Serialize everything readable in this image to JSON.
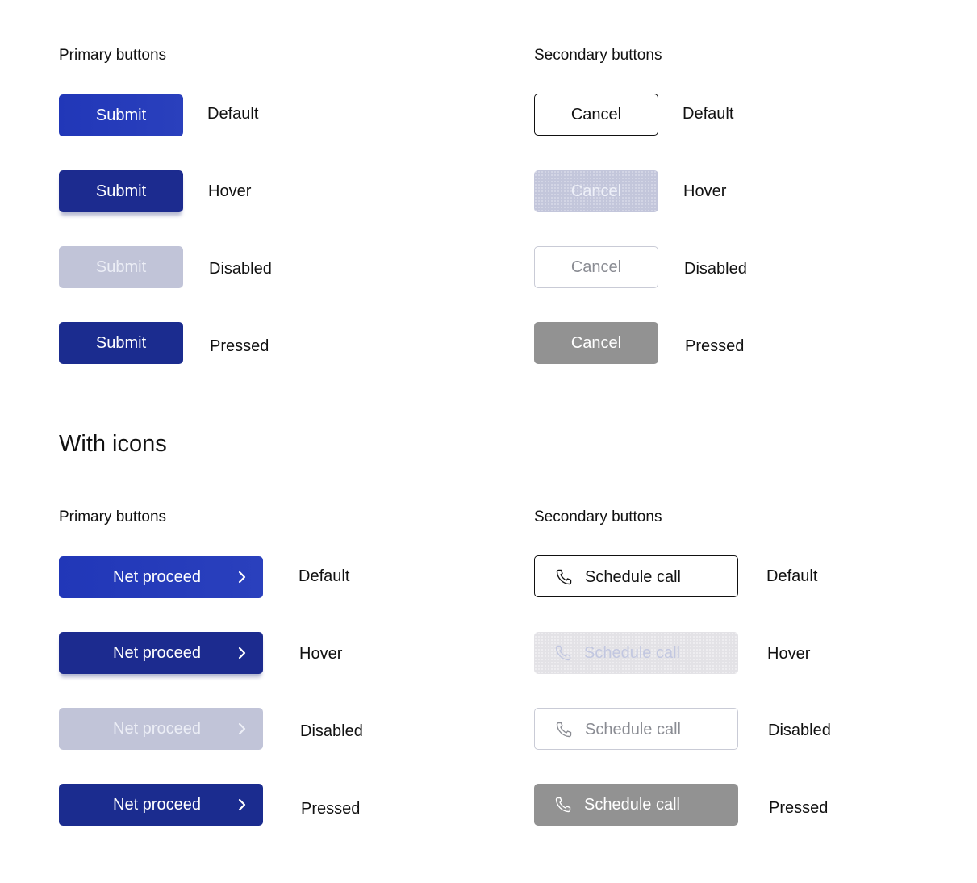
{
  "top": {
    "primary_heading": "Primary buttons",
    "secondary_heading": "Secondary buttons",
    "primary_buttons": [
      {
        "label": "Submit",
        "state": "Default"
      },
      {
        "label": "Submit",
        "state": "Hover"
      },
      {
        "label": "Submit",
        "state": "Disabled"
      },
      {
        "label": "Submit",
        "state": "Pressed"
      }
    ],
    "secondary_buttons": [
      {
        "label": "Cancel",
        "state": "Default"
      },
      {
        "label": "Cancel",
        "state": "Hover"
      },
      {
        "label": "Cancel",
        "state": "Disabled"
      },
      {
        "label": "Cancel",
        "state": "Pressed"
      }
    ]
  },
  "icons_section": {
    "title": "With icons",
    "primary_heading": "Primary buttons",
    "secondary_heading": "Secondary buttons",
    "primary_icon": "chevron-right-icon",
    "secondary_icon": "phone-icon",
    "primary_buttons": [
      {
        "label": "Net proceed",
        "state": "Default"
      },
      {
        "label": "Net proceed",
        "state": "Hover"
      },
      {
        "label": "Net proceed",
        "state": "Disabled"
      },
      {
        "label": "Net proceed",
        "state": "Pressed"
      }
    ],
    "secondary_buttons": [
      {
        "label": "Schedule call",
        "state": "Default"
      },
      {
        "label": "Schedule call",
        "state": "Hover"
      },
      {
        "label": "Schedule call",
        "state": "Disabled"
      },
      {
        "label": "Schedule call",
        "state": "Pressed"
      }
    ]
  },
  "colors": {
    "primary_default": "#2137b8",
    "primary_hover": "#1c2b8f",
    "primary_disabled": "#c1c4d8",
    "primary_pressed": "#1b2c8f",
    "secondary_pressed": "#929292"
  }
}
